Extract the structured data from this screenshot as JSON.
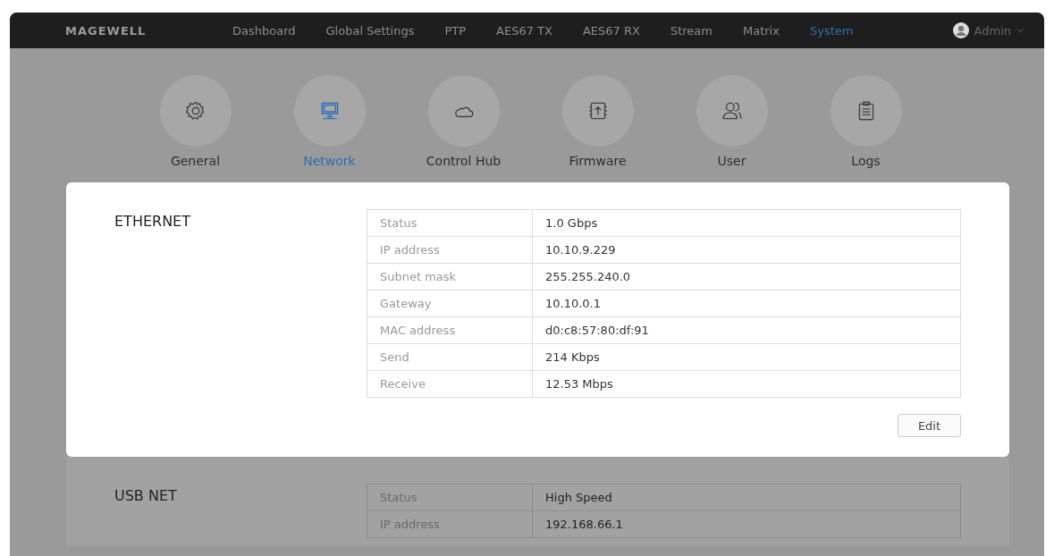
{
  "header": {
    "logo": "MAGEWELL",
    "nav": [
      {
        "label": "Dashboard",
        "selected": false
      },
      {
        "label": "Global Settings",
        "selected": false
      },
      {
        "label": "PTP",
        "selected": false
      },
      {
        "label": "AES67 TX",
        "selected": false
      },
      {
        "label": "AES67 RX",
        "selected": false
      },
      {
        "label": "Stream",
        "selected": false
      },
      {
        "label": "Matrix",
        "selected": false
      },
      {
        "label": "System",
        "selected": true
      }
    ],
    "user": "Admin"
  },
  "categories": [
    {
      "label": "General",
      "selected": false
    },
    {
      "label": "Network",
      "selected": true
    },
    {
      "label": "Control Hub",
      "selected": false
    },
    {
      "label": "Firmware",
      "selected": false
    },
    {
      "label": "User",
      "selected": false
    },
    {
      "label": "Logs",
      "selected": false
    }
  ],
  "sections": [
    {
      "title": "ETHERNET",
      "highlighted": true,
      "rows": [
        {
          "label": "Status",
          "value": "1.0 Gbps"
        },
        {
          "label": "IP address",
          "value": "10.10.9.229"
        },
        {
          "label": "Subnet mask",
          "value": "255.255.240.0"
        },
        {
          "label": "Gateway",
          "value": "10.10.0.1"
        },
        {
          "label": "MAC address",
          "value": "d0:c8:57:80:df:91"
        },
        {
          "label": "Send",
          "value": "214 Kbps"
        },
        {
          "label": "Receive",
          "value": "12.53 Mbps"
        }
      ],
      "button": "Edit"
    },
    {
      "title": "USB NET",
      "highlighted": false,
      "rows": [
        {
          "label": "Status",
          "value": "High Speed"
        },
        {
          "label": "IP address",
          "value": "192.168.66.1"
        }
      ]
    }
  ]
}
